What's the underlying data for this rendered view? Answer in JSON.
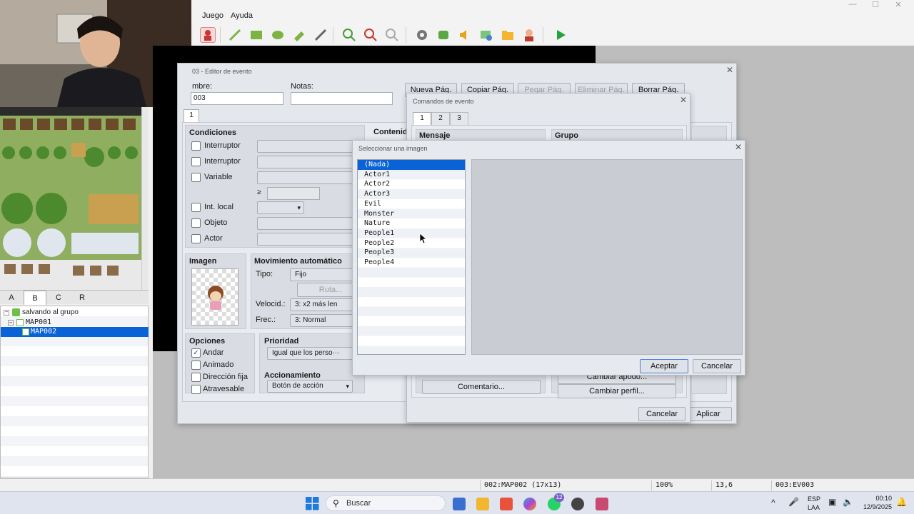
{
  "menu": {
    "items": [
      "Juego",
      "Ayuda"
    ]
  },
  "window_controls": {
    "minimize": "—",
    "maximize": "☐",
    "close": "✕"
  },
  "toolbar": {
    "icons": [
      "character-icon",
      "pencil-icon",
      "rectangle-icon",
      "ellipse-icon",
      "fill-icon",
      "shadow-pen-icon",
      "zoom-in-icon",
      "zoom-out-icon",
      "zoom-reset-icon",
      "gear-icon",
      "puzzle-icon",
      "sound-icon",
      "resource-icon",
      "folder-icon",
      "person-icon",
      "play-icon"
    ]
  },
  "tile_tabs": [
    "A",
    "B",
    "C",
    "R"
  ],
  "map_tree": {
    "project": "salvando al grupo",
    "maps": [
      "MAP001",
      "MAP002"
    ]
  },
  "status": {
    "map": "002:MAP002 (17x13)",
    "zoom": "100%",
    "coords": "13,6",
    "event": "003:EV003"
  },
  "event_editor": {
    "title": "03 - Editor de evento",
    "name_label": "mbre:",
    "name_value": "003",
    "notes_label": "Notas:",
    "page_tab": "1",
    "buttons": {
      "new_page": "Nueva Pág.",
      "copy_page": "Copiar Pág.",
      "paste_page": "Pegar Pág.",
      "delete_page": "Eliminar Pág.",
      "clear_page": "Borrar Pág."
    },
    "conditions": {
      "label": "Condiciones",
      "items": [
        "Interruptor",
        "Interruptor",
        "Variable",
        "Int. local",
        "Objeto",
        "Actor"
      ],
      "ge": "≥"
    },
    "content_label": "Contenid",
    "image_label": "Imagen",
    "auto_move": {
      "label": "Movimiento automático",
      "type_label": "Tipo:",
      "type_value": "Fijo",
      "route_button": "Ruta...",
      "speed_label": "Velocid.:",
      "speed_value": "3: x2 más len",
      "freq_label": "Frec.:",
      "freq_value": "3: Normal"
    },
    "options": {
      "label": "Opciones",
      "items": [
        "Andar",
        "Animado",
        "Dirección fija",
        "Atravesable"
      ],
      "checked": [
        true,
        false,
        false,
        false
      ]
    },
    "priority": {
      "label": "Prioridad",
      "value": "Igual que los perso···"
    },
    "trigger": {
      "label": "Accionamiento",
      "value": "Botón de acción"
    },
    "apply": "Aplicar"
  },
  "commands_dialog": {
    "title": "Comandos de evento",
    "tabs": [
      "1",
      "2",
      "3"
    ],
    "group_message": "Mensaje",
    "group_party": "Grupo",
    "buttons": [
      "Comentario...",
      "Cambiar apodo...",
      "Cambiar perfil..."
    ],
    "cancel": "Cancelar"
  },
  "image_dialog": {
    "title": "Seleccionar una imagen",
    "items": [
      "(Nada)",
      "Actor1",
      "Actor2",
      "Actor3",
      "Evil",
      "Monster",
      "Nature",
      "People1",
      "People2",
      "People3",
      "People4"
    ],
    "selected_index": 0,
    "ok": "Aceptar",
    "cancel": "Cancelar"
  },
  "taskbar": {
    "search_placeholder": "Buscar",
    "lang_top": "ESP",
    "lang_bottom": "LAA",
    "time": "00:10",
    "date": "12/9/2025",
    "badge": "12"
  }
}
